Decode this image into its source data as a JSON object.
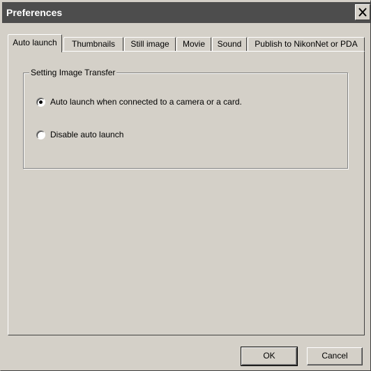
{
  "window": {
    "title": "Preferences",
    "close_icon": "close-icon"
  },
  "tabs": [
    {
      "label": "Auto launch",
      "active": true
    },
    {
      "label": "Thumbnails",
      "active": false
    },
    {
      "label": "Still image",
      "active": false
    },
    {
      "label": "Movie",
      "active": false
    },
    {
      "label": "Sound",
      "active": false
    },
    {
      "label": "Publish to NikonNet or PDA",
      "active": false
    }
  ],
  "panel": {
    "group_title": "Setting Image Transfer",
    "options": [
      {
        "label": "Auto launch when connected to a camera or a card.",
        "checked": true
      },
      {
        "label": "Disable auto launch",
        "checked": false
      }
    ]
  },
  "buttons": {
    "ok": "OK",
    "cancel": "Cancel"
  }
}
